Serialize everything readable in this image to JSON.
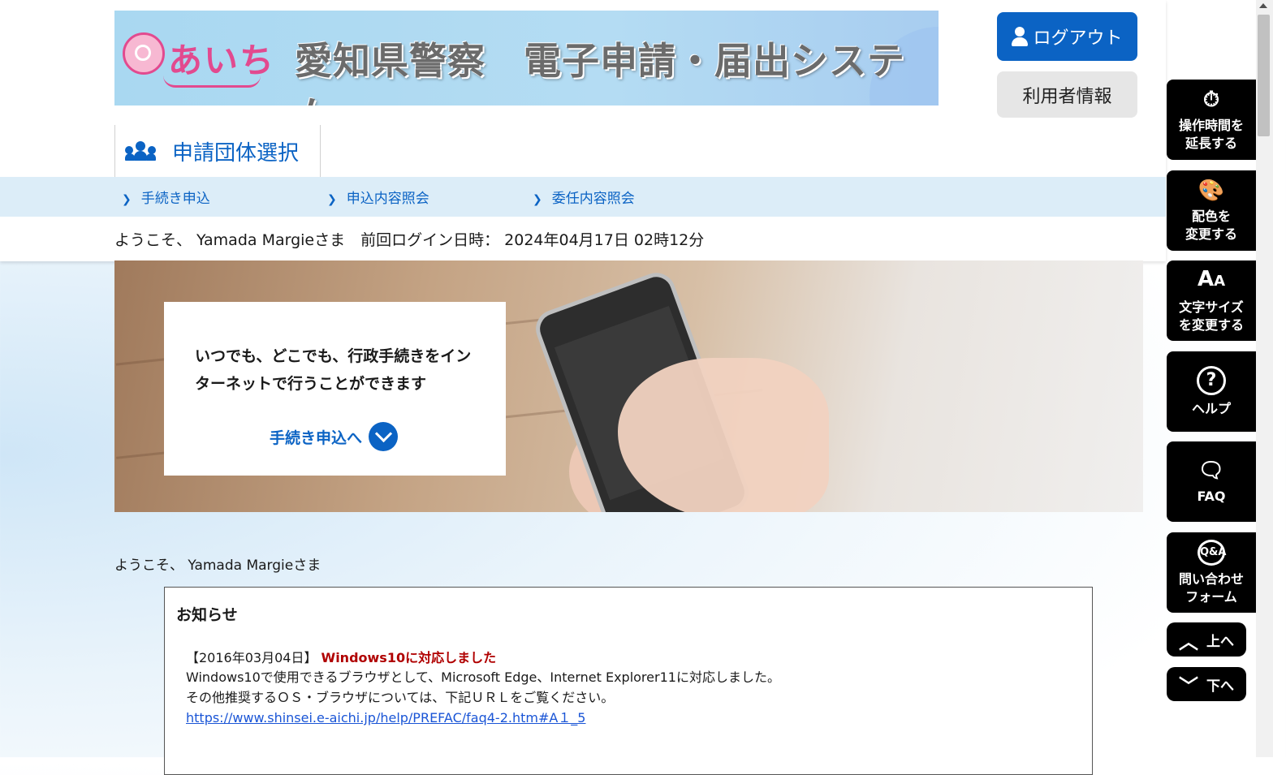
{
  "banner": {
    "logo_text": "あいち",
    "title": "愛知県警察　電子申請・届出システム"
  },
  "header": {
    "logout_label": "ログアウト",
    "user_info_label": "利用者情報",
    "group_select_label": "申請団体選択"
  },
  "nav": {
    "items": [
      {
        "label": "手続き申込"
      },
      {
        "label": "申込内容照会"
      },
      {
        "label": "委任内容照会"
      }
    ]
  },
  "welcome_bar": "ようこそ、 Yamada  Margieさま　前回ログイン日時： 2024年04月17日 02時12分",
  "hero": {
    "text": "いつでも、どこでも、行政手続きをインターネットで行うことができます",
    "link_label": "手続き申込へ"
  },
  "welcome2": "ようこそ、 Yamada  Margieさま",
  "notice": {
    "title": "お知らせ",
    "date": "【2016年03月04日】",
    "headline": "Windows10に対応しました",
    "line1": "Windows10で使用できるブラウザとして、Microsoft Edge、Internet Explorer11に対応しました。",
    "line2": "その他推奨するＯＳ・ブラウザについては、下記ＵＲＬをご覧ください。",
    "link": "https://www.shinsei.e-aichi.jp/help/PREFAC/faq4-2.htm#A１_5"
  },
  "side_panel": {
    "extend_time": "操作時間を延長する",
    "extend_time_l1": "操作時間を",
    "extend_time_l2": "延長する",
    "color_l1": "配色を",
    "color_l2": "変更する",
    "font_l1": "文字サイズ",
    "font_l2": "を変更する",
    "help": "ヘルプ",
    "faq": "FAQ",
    "contact_l1": "問い合わせ",
    "contact_l2": "フォーム",
    "up": "上へ",
    "down": "下へ"
  },
  "icons": {
    "extend": "stopwatch-icon",
    "color": "palette-icon",
    "font": "font-size-icon",
    "help": "question-icon",
    "faq": "chat-icon",
    "contact": "qa-bubble-icon"
  },
  "colors": {
    "primary": "#0b63c4",
    "notice_red": "#b00000",
    "side_bg": "#000000"
  }
}
